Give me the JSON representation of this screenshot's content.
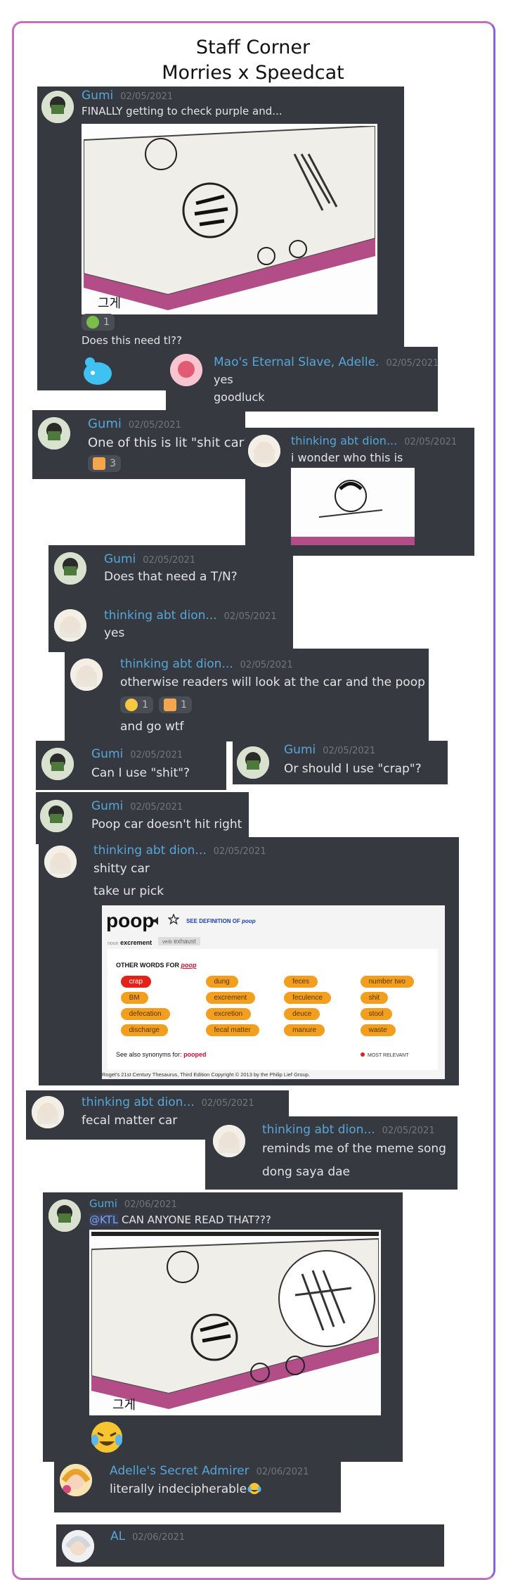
{
  "page": {
    "title_line1": "Staff Corner",
    "title_line2": "Morries x Speedcat"
  },
  "colors": {
    "card_bg": "#36393f",
    "username": "#56a7d9",
    "timestamp": "#72767d",
    "text": "#dcddde",
    "frame": "#c86cc0"
  },
  "messages": [
    {
      "author": "Gumi",
      "date": "02/05/2021",
      "lines": [
        "FINALLY getting to check purple and..."
      ],
      "reactions": [
        {
          "icon": "clover-emoji",
          "count": "1"
        }
      ],
      "after_text": "Does this need tl??"
    },
    {
      "author": "Mao's Eternal Slave, Adelle.",
      "date": "02/05/2021",
      "lines": [
        "yes",
        "goodluck"
      ]
    },
    {
      "author": "Gumi",
      "date": "02/05/2021",
      "lines": [
        "One of this is lit \"shit car\""
      ],
      "reactions": [
        {
          "icon": "sushi-emoji",
          "count": "3"
        }
      ]
    },
    {
      "author": "thinking abt dion...",
      "date": "02/05/2021",
      "lines": [
        "i wonder who this is"
      ]
    },
    {
      "author": "Gumi",
      "date": "02/05/2021",
      "lines": [
        "Does that need a T/N?"
      ]
    },
    {
      "author": "thinking abt dion...",
      "date": "02/05/2021",
      "lines": [
        "yes"
      ]
    },
    {
      "author": "thinking abt dion...",
      "date": "02/05/2021",
      "lines": [
        "otherwise readers will look at the car and the poop",
        "and go wtf"
      ],
      "reactions": [
        {
          "icon": "rofl-emoji",
          "count": "1"
        },
        {
          "icon": "sushi-emoji",
          "count": "1"
        }
      ]
    },
    {
      "author": "Gumi",
      "date": "02/05/2021",
      "lines": [
        "Can I use \"shit\"?"
      ]
    },
    {
      "author": "Gumi",
      "date": "02/05/2021",
      "lines": [
        "Or should I use \"crap\"?"
      ]
    },
    {
      "author": "Gumi",
      "date": "02/05/2021",
      "lines": [
        "Poop car doesn't hit right"
      ]
    },
    {
      "author": "thinking abt dion...",
      "date": "02/05/2021",
      "lines": [
        "shitty car",
        "take ur pick"
      ]
    },
    {
      "author": "thinking abt dion...",
      "date": "02/05/2021",
      "lines": [
        "fecal matter car"
      ]
    },
    {
      "author": "thinking abt dion...",
      "date": "02/05/2021",
      "lines": [
        "reminds me of the meme song",
        "dong saya dae"
      ]
    },
    {
      "author": "Gumi",
      "date": "02/06/2021",
      "mention": "@KTL",
      "lines": [
        " CAN ANYONE READ THAT???"
      ]
    },
    {
      "author": "Adelle's Secret Admirer",
      "date": "02/06/2021",
      "lines": [
        "literally indecipherable"
      ]
    },
    {
      "author": "AL",
      "date": "02/06/2021",
      "lines": [
        ""
      ]
    }
  ],
  "thesaurus": {
    "headword": "poop",
    "see_definition": "SEE DEFINITION OF",
    "see_definition_word": "poop",
    "tab_noun_pos": "noun",
    "tab_noun_word": "excrement",
    "tab_verb_pos": "verb",
    "tab_verb_word": "exhaust",
    "other_words_label": "OTHER WORDS FOR",
    "other_words_word": "poop",
    "synonyms": [
      "crap",
      "dung",
      "feces",
      "number two",
      "BM",
      "excrement",
      "feculence",
      "shit",
      "defecation",
      "excretion",
      "deuce",
      "stool",
      "discharge",
      "fecal matter",
      "manure",
      "waste"
    ],
    "see_also_label": "See also synonyms for:",
    "see_also_word": "pooped",
    "most_relevant": "MOST RELEVANT",
    "footer": "Roget's 21st Century Thesaurus, Third Edition Copyright © 2013 by the Philip Lief Group."
  },
  "manga_text": "그게"
}
